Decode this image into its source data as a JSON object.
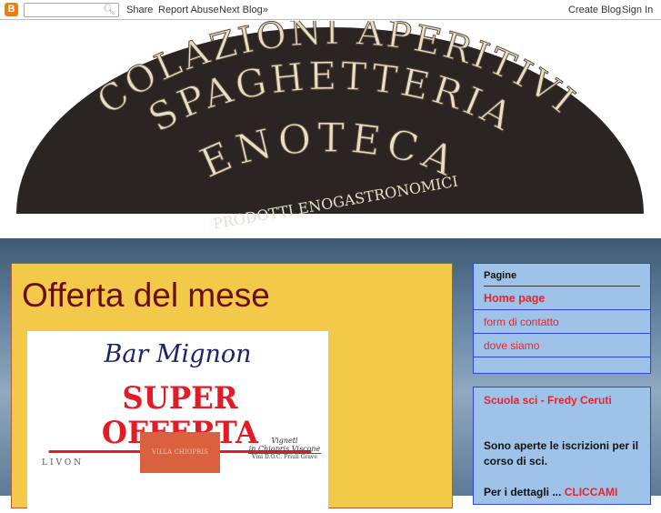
{
  "navbar": {
    "search_placeholder": "",
    "share": "Share",
    "report_abuse": "Report Abuse",
    "next_blog": "Next Blog»",
    "create_blog": "Create Blog",
    "sign_in": "Sign In"
  },
  "banner": {
    "line1": "COLAZIONI APERITIVI",
    "line2": "SPAGHETTERIA",
    "line3": "ENOTECA",
    "line4": "PRODOTTI ENOGASTRONOMICI"
  },
  "post": {
    "title": "Offerta del mese",
    "image": {
      "brand": "Bar Mignon",
      "headline": "SUPER OFFERTA",
      "logo1": "LIVON",
      "logo2": "VILLA CHIOPRIS",
      "logo3_line1": "Vigneti",
      "logo3_line2": "in Chiopris Viscone",
      "logo3_line3": "Vini D.O.C. Friuli Grave"
    }
  },
  "sidebar": {
    "pages": {
      "title": "Pagine",
      "items": [
        {
          "label": "Home page"
        },
        {
          "label": "form di contatto"
        },
        {
          "label": "dove siamo"
        }
      ]
    },
    "ski": {
      "title": "Scuola sci - Fredy Ceruti",
      "text": "Sono aperte le iscrizioni per il corso di sci.",
      "details": "Per i dettagli ...",
      "link": "CLICCAMI"
    }
  }
}
